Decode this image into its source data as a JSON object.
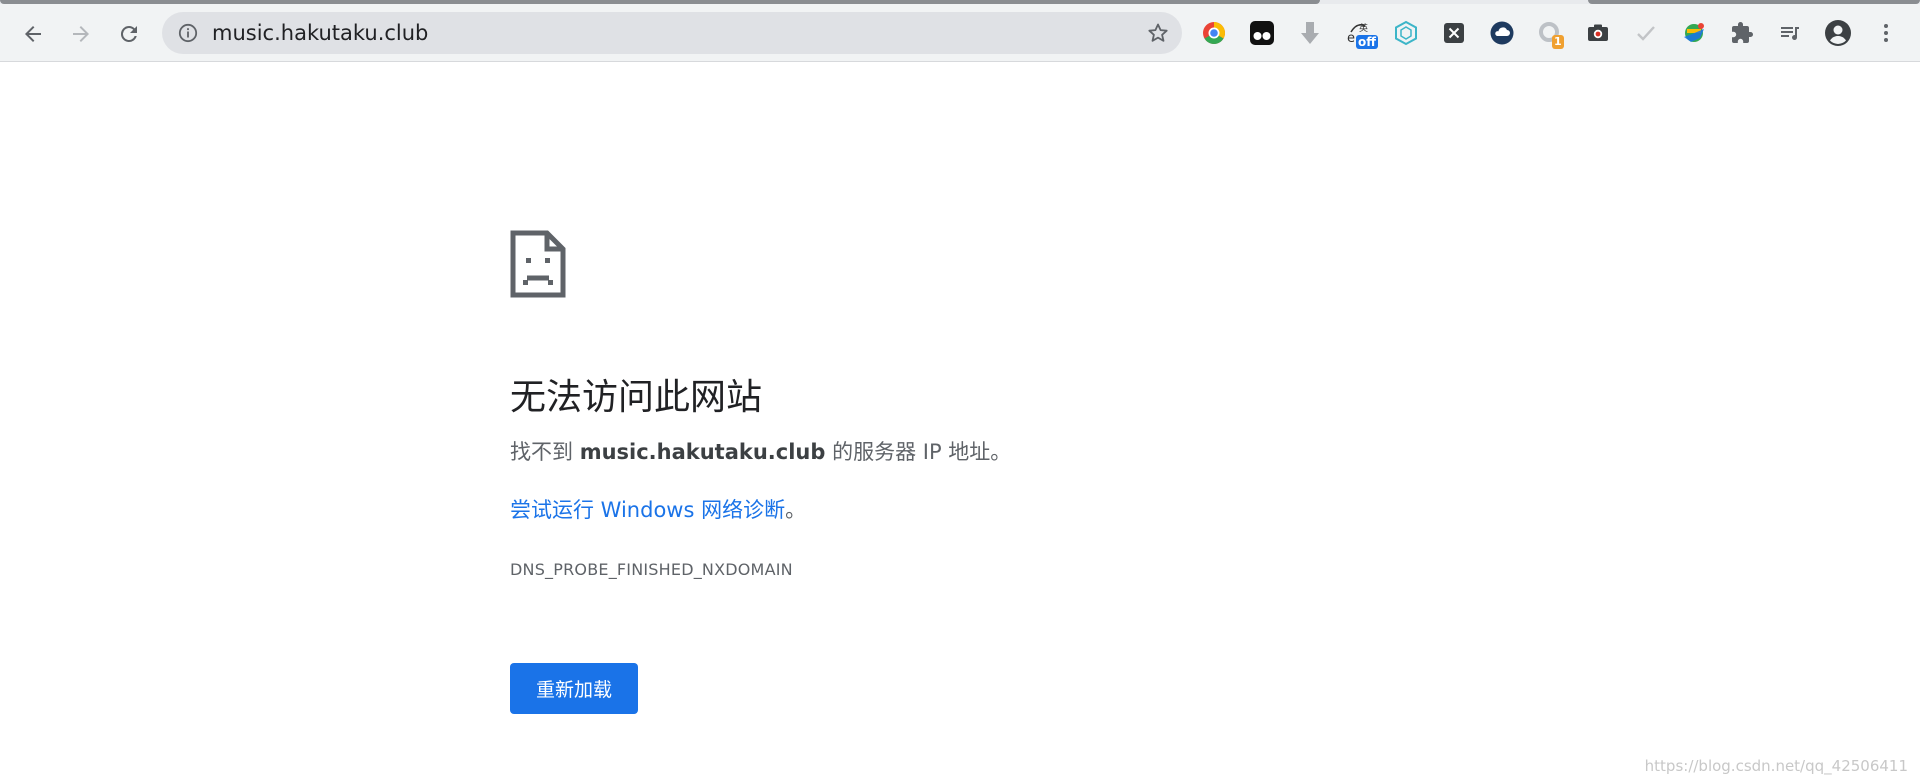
{
  "browser": {
    "url": "music.hakutaku.club",
    "icons": {
      "back": "arrow-left-icon",
      "forward": "arrow-right-icon",
      "reload": "reload-icon",
      "site_info": "info-icon",
      "bookmark": "star-icon",
      "profile": "account-circle-icon",
      "menu": "more-vert-icon"
    },
    "extensions": [
      {
        "name": "chrome-color-extension"
      },
      {
        "name": "tampermonkey-extension"
      },
      {
        "name": "download-arrow-extension"
      },
      {
        "name": "translate-off-extension",
        "badge": "off"
      },
      {
        "name": "hex-web-extension"
      },
      {
        "name": "x-extension"
      },
      {
        "name": "cloud-sync-extension"
      },
      {
        "name": "ring-extension",
        "badge": "1"
      },
      {
        "name": "camera-extension"
      },
      {
        "name": "check-extension"
      },
      {
        "name": "globe-extension"
      },
      {
        "name": "puzzle-extensions-menu"
      },
      {
        "name": "reading-list-extension"
      }
    ]
  },
  "error": {
    "icon": "sad-document-icon",
    "title": "无法访问此网站",
    "summary_prefix": "找不到 ",
    "summary_host": "music.hakutaku.club",
    "summary_suffix": " 的服务器 IP 地址。",
    "suggestion_link": "尝试运行 Windows 网络诊断",
    "suggestion_end": "。",
    "code": "DNS_PROBE_FINISHED_NXDOMAIN",
    "reload_label": "重新加载"
  },
  "watermark": "https://blog.csdn.net/qq_42506411",
  "colors": {
    "accent": "#1a73e8",
    "toolbar": "#f1f3f4",
    "omnibox": "#dfe1e5"
  }
}
